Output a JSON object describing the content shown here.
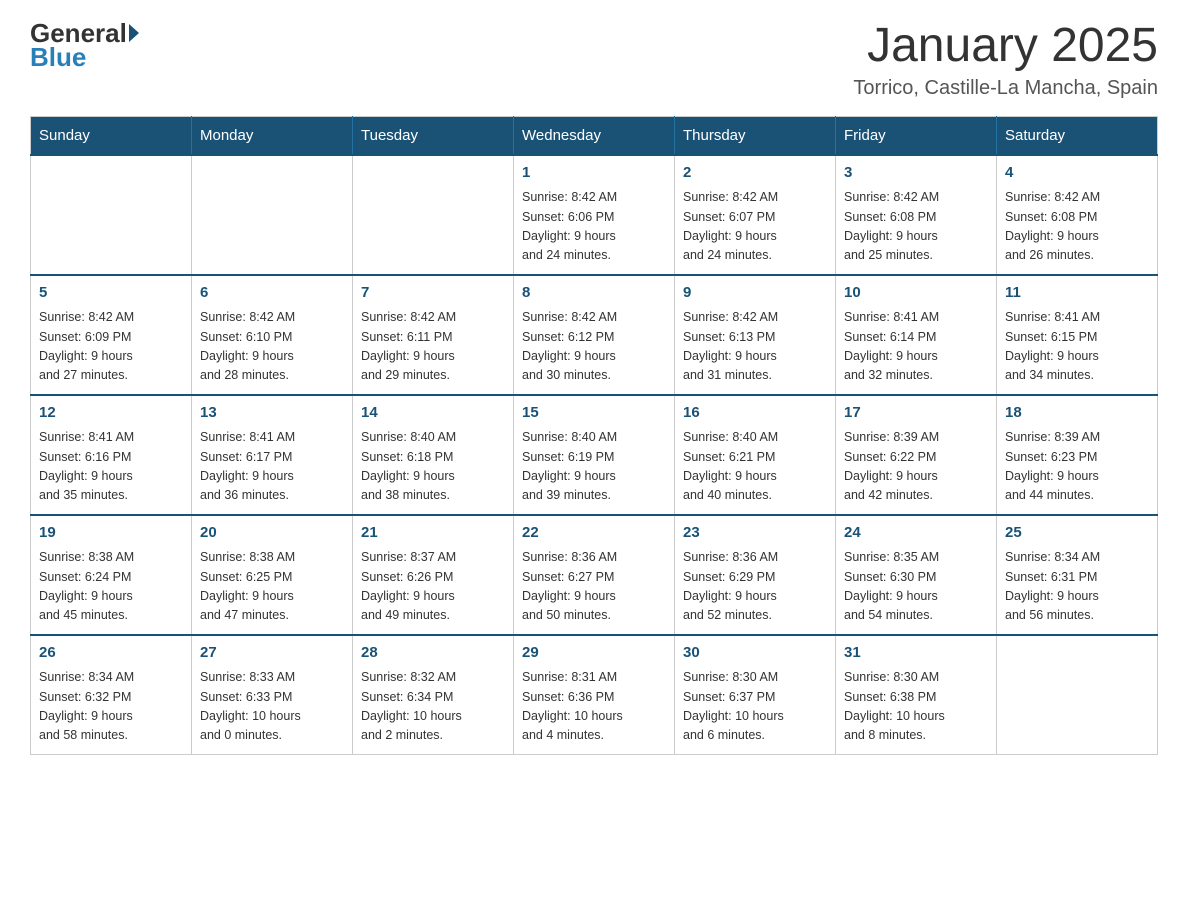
{
  "logo": {
    "general": "General",
    "blue": "Blue"
  },
  "title": "January 2025",
  "subtitle": "Torrico, Castille-La Mancha, Spain",
  "days_of_week": [
    "Sunday",
    "Monday",
    "Tuesday",
    "Wednesday",
    "Thursday",
    "Friday",
    "Saturday"
  ],
  "weeks": [
    [
      {
        "day": "",
        "info": ""
      },
      {
        "day": "",
        "info": ""
      },
      {
        "day": "",
        "info": ""
      },
      {
        "day": "1",
        "info": "Sunrise: 8:42 AM\nSunset: 6:06 PM\nDaylight: 9 hours\nand 24 minutes."
      },
      {
        "day": "2",
        "info": "Sunrise: 8:42 AM\nSunset: 6:07 PM\nDaylight: 9 hours\nand 24 minutes."
      },
      {
        "day": "3",
        "info": "Sunrise: 8:42 AM\nSunset: 6:08 PM\nDaylight: 9 hours\nand 25 minutes."
      },
      {
        "day": "4",
        "info": "Sunrise: 8:42 AM\nSunset: 6:08 PM\nDaylight: 9 hours\nand 26 minutes."
      }
    ],
    [
      {
        "day": "5",
        "info": "Sunrise: 8:42 AM\nSunset: 6:09 PM\nDaylight: 9 hours\nand 27 minutes."
      },
      {
        "day": "6",
        "info": "Sunrise: 8:42 AM\nSunset: 6:10 PM\nDaylight: 9 hours\nand 28 minutes."
      },
      {
        "day": "7",
        "info": "Sunrise: 8:42 AM\nSunset: 6:11 PM\nDaylight: 9 hours\nand 29 minutes."
      },
      {
        "day": "8",
        "info": "Sunrise: 8:42 AM\nSunset: 6:12 PM\nDaylight: 9 hours\nand 30 minutes."
      },
      {
        "day": "9",
        "info": "Sunrise: 8:42 AM\nSunset: 6:13 PM\nDaylight: 9 hours\nand 31 minutes."
      },
      {
        "day": "10",
        "info": "Sunrise: 8:41 AM\nSunset: 6:14 PM\nDaylight: 9 hours\nand 32 minutes."
      },
      {
        "day": "11",
        "info": "Sunrise: 8:41 AM\nSunset: 6:15 PM\nDaylight: 9 hours\nand 34 minutes."
      }
    ],
    [
      {
        "day": "12",
        "info": "Sunrise: 8:41 AM\nSunset: 6:16 PM\nDaylight: 9 hours\nand 35 minutes."
      },
      {
        "day": "13",
        "info": "Sunrise: 8:41 AM\nSunset: 6:17 PM\nDaylight: 9 hours\nand 36 minutes."
      },
      {
        "day": "14",
        "info": "Sunrise: 8:40 AM\nSunset: 6:18 PM\nDaylight: 9 hours\nand 38 minutes."
      },
      {
        "day": "15",
        "info": "Sunrise: 8:40 AM\nSunset: 6:19 PM\nDaylight: 9 hours\nand 39 minutes."
      },
      {
        "day": "16",
        "info": "Sunrise: 8:40 AM\nSunset: 6:21 PM\nDaylight: 9 hours\nand 40 minutes."
      },
      {
        "day": "17",
        "info": "Sunrise: 8:39 AM\nSunset: 6:22 PM\nDaylight: 9 hours\nand 42 minutes."
      },
      {
        "day": "18",
        "info": "Sunrise: 8:39 AM\nSunset: 6:23 PM\nDaylight: 9 hours\nand 44 minutes."
      }
    ],
    [
      {
        "day": "19",
        "info": "Sunrise: 8:38 AM\nSunset: 6:24 PM\nDaylight: 9 hours\nand 45 minutes."
      },
      {
        "day": "20",
        "info": "Sunrise: 8:38 AM\nSunset: 6:25 PM\nDaylight: 9 hours\nand 47 minutes."
      },
      {
        "day": "21",
        "info": "Sunrise: 8:37 AM\nSunset: 6:26 PM\nDaylight: 9 hours\nand 49 minutes."
      },
      {
        "day": "22",
        "info": "Sunrise: 8:36 AM\nSunset: 6:27 PM\nDaylight: 9 hours\nand 50 minutes."
      },
      {
        "day": "23",
        "info": "Sunrise: 8:36 AM\nSunset: 6:29 PM\nDaylight: 9 hours\nand 52 minutes."
      },
      {
        "day": "24",
        "info": "Sunrise: 8:35 AM\nSunset: 6:30 PM\nDaylight: 9 hours\nand 54 minutes."
      },
      {
        "day": "25",
        "info": "Sunrise: 8:34 AM\nSunset: 6:31 PM\nDaylight: 9 hours\nand 56 minutes."
      }
    ],
    [
      {
        "day": "26",
        "info": "Sunrise: 8:34 AM\nSunset: 6:32 PM\nDaylight: 9 hours\nand 58 minutes."
      },
      {
        "day": "27",
        "info": "Sunrise: 8:33 AM\nSunset: 6:33 PM\nDaylight: 10 hours\nand 0 minutes."
      },
      {
        "day": "28",
        "info": "Sunrise: 8:32 AM\nSunset: 6:34 PM\nDaylight: 10 hours\nand 2 minutes."
      },
      {
        "day": "29",
        "info": "Sunrise: 8:31 AM\nSunset: 6:36 PM\nDaylight: 10 hours\nand 4 minutes."
      },
      {
        "day": "30",
        "info": "Sunrise: 8:30 AM\nSunset: 6:37 PM\nDaylight: 10 hours\nand 6 minutes."
      },
      {
        "day": "31",
        "info": "Sunrise: 8:30 AM\nSunset: 6:38 PM\nDaylight: 10 hours\nand 8 minutes."
      },
      {
        "day": "",
        "info": ""
      }
    ]
  ]
}
